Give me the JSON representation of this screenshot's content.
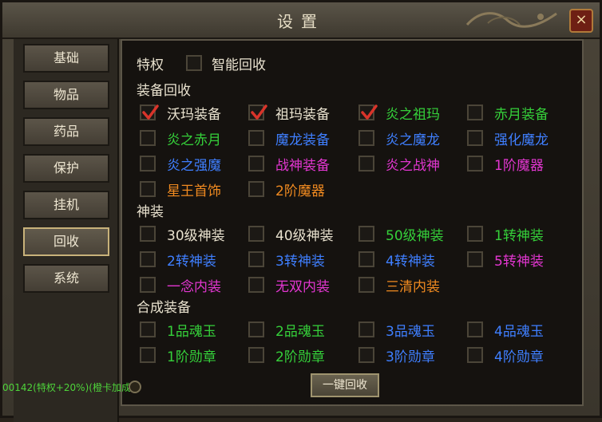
{
  "window": {
    "title": "设置",
    "close_label": "×"
  },
  "sidebar": {
    "items": [
      {
        "label": "基础",
        "active": false
      },
      {
        "label": "物品",
        "active": false
      },
      {
        "label": "药品",
        "active": false
      },
      {
        "label": "保护",
        "active": false
      },
      {
        "label": "挂机",
        "active": false
      },
      {
        "label": "回收",
        "active": true
      },
      {
        "label": "系统",
        "active": false
      }
    ]
  },
  "privilege": {
    "label": "特权",
    "option": {
      "label": "智能回收",
      "checked": false,
      "color": "#e9e2cf"
    }
  },
  "sections": [
    {
      "title": "装备回收",
      "items": [
        {
          "label": "沃玛装备",
          "checked": true,
          "color": "#e9e2cf"
        },
        {
          "label": "祖玛装备",
          "checked": true,
          "color": "#e9e2cf"
        },
        {
          "label": "炎之祖玛",
          "checked": true,
          "color": "#35d03a"
        },
        {
          "label": "赤月装备",
          "checked": false,
          "color": "#35d03a"
        },
        {
          "label": "炎之赤月",
          "checked": false,
          "color": "#35d03a"
        },
        {
          "label": "魔龙装备",
          "checked": false,
          "color": "#3f7fff"
        },
        {
          "label": "炎之魔龙",
          "checked": false,
          "color": "#3f7fff"
        },
        {
          "label": "强化魔龙",
          "checked": false,
          "color": "#3f7fff"
        },
        {
          "label": "炎之强魔",
          "checked": false,
          "color": "#3f7fff"
        },
        {
          "label": "战神装备",
          "checked": false,
          "color": "#e236d0"
        },
        {
          "label": "炎之战神",
          "checked": false,
          "color": "#e236d0"
        },
        {
          "label": "1阶魔器",
          "checked": false,
          "color": "#e236d0"
        },
        {
          "label": "星王首饰",
          "checked": false,
          "color": "#f08a20"
        },
        {
          "label": "2阶魔器",
          "checked": false,
          "color": "#f08a20"
        }
      ]
    },
    {
      "title": "神装",
      "items": [
        {
          "label": "30级神装",
          "checked": false,
          "color": "#e9e2cf"
        },
        {
          "label": "40级神装",
          "checked": false,
          "color": "#e9e2cf"
        },
        {
          "label": "50级神装",
          "checked": false,
          "color": "#35d03a"
        },
        {
          "label": "1转神装",
          "checked": false,
          "color": "#35d03a"
        },
        {
          "label": "2转神装",
          "checked": false,
          "color": "#3f7fff"
        },
        {
          "label": "3转神装",
          "checked": false,
          "color": "#3f7fff"
        },
        {
          "label": "4转神装",
          "checked": false,
          "color": "#3f7fff"
        },
        {
          "label": "5转神装",
          "checked": false,
          "color": "#e236d0"
        },
        {
          "label": "一念内装",
          "checked": false,
          "color": "#e236d0"
        },
        {
          "label": "无双内装",
          "checked": false,
          "color": "#e236d0"
        },
        {
          "label": "三清内装",
          "checked": false,
          "color": "#f08a20"
        }
      ]
    },
    {
      "title": "合成装备",
      "items": [
        {
          "label": "1品魂玉",
          "checked": false,
          "color": "#35d03a"
        },
        {
          "label": "2品魂玉",
          "checked": false,
          "color": "#35d03a"
        },
        {
          "label": "3品魂玉",
          "checked": false,
          "color": "#3f7fff"
        },
        {
          "label": "4品魂玉",
          "checked": false,
          "color": "#3f7fff"
        },
        {
          "label": "1阶勋章",
          "checked": false,
          "color": "#35d03a"
        },
        {
          "label": "2阶勋章",
          "checked": false,
          "color": "#35d03a"
        },
        {
          "label": "3阶勋章",
          "checked": false,
          "color": "#3f7fff"
        },
        {
          "label": "4阶勋章",
          "checked": false,
          "color": "#3f7fff"
        }
      ]
    }
  ],
  "actions": {
    "recycle_all_label": "一键回收"
  },
  "status": {
    "text": "00142(特权+20%)(橙卡加成)"
  }
}
